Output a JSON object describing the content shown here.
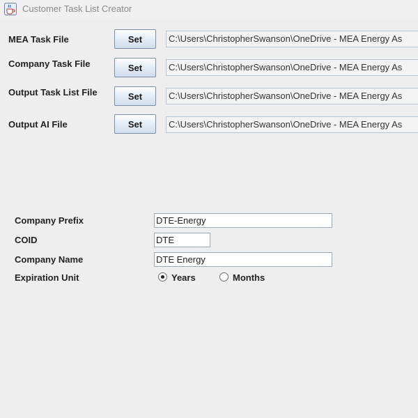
{
  "window": {
    "title": "Customer Task List Creator",
    "icon": "java-cup-icon"
  },
  "file_rows": [
    {
      "label": "MEA Task File",
      "button": "Set",
      "path": "C:\\Users\\ChristopherSwanson\\OneDrive - MEA Energy As"
    },
    {
      "label": "Company Task File",
      "button": "Set",
      "path": "C:\\Users\\ChristopherSwanson\\OneDrive - MEA Energy As"
    },
    {
      "label": "Output Task List File",
      "button": "Set",
      "path": "C:\\Users\\ChristopherSwanson\\OneDrive - MEA Energy As"
    },
    {
      "label": "Output AI File",
      "button": "Set",
      "path": "C:\\Users\\ChristopherSwanson\\OneDrive - MEA Energy As"
    }
  ],
  "form": {
    "company_prefix": {
      "label": "Company Prefix",
      "value": "DTE-Energy"
    },
    "coid": {
      "label": "COID",
      "value": "DTE"
    },
    "company_name": {
      "label": "Company Name",
      "value": "DTE Energy"
    },
    "expiration_unit": {
      "label": "Expiration Unit",
      "options": [
        "Years",
        "Months"
      ],
      "selected": "Years"
    }
  }
}
